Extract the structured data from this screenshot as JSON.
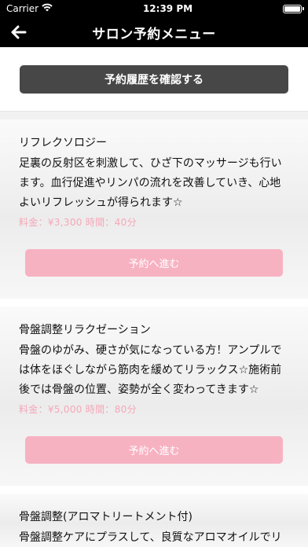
{
  "status": {
    "carrier": "Carrier",
    "time": "12:39 PM"
  },
  "nav": {
    "title": "サロン予約メニュー",
    "back_icon": "back-arrow-icon"
  },
  "history_button": "予約履歴を確認する",
  "menu": [
    {
      "name": "リフレクソロジー",
      "description": "足裏の反射区を刺激して、ひざ下のマッサージも行います。血行促進やリンパの流れを改善していき、心地よいリフレッシュが得られます☆",
      "price_line": "料金：¥3,300 時間：40分",
      "button": "予約へ進む"
    },
    {
      "name": "骨盤調整リラクゼーション",
      "description": "骨盤のゆがみ、硬さが気になっている方！アンプルでは体をほぐしながら筋肉を緩めてリラックス☆施術前後では骨盤の位置、姿勢が全く変わってきます☆",
      "price_line": "料金：¥5,000 時間：80分",
      "button": "予約へ進む"
    },
    {
      "name": "骨盤調整(アロマトリートメント付)",
      "description": "骨盤調整ケアにプラスして、良質なアロマオイルでリ"
    }
  ],
  "colors": {
    "accent_pink": "#f7b2c2",
    "price_pink": "#f5a7b8",
    "history_button_bg": "#474747"
  }
}
